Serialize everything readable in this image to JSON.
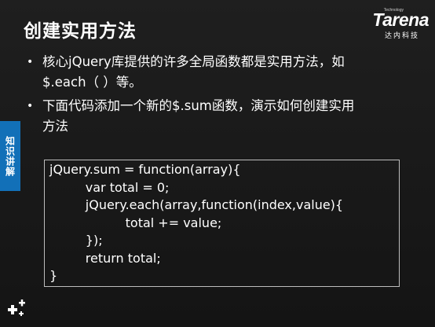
{
  "title": "创建实用方法",
  "logo": {
    "small": "Technology",
    "main": "Tarena",
    "sub": "达内科技"
  },
  "bullets": [
    {
      "line1": "核心jQuery库提供的许多全局函数都是实用方法，如",
      "line2": "$.each（ ）等。"
    },
    {
      "line1": "下面代码添加一个新的$.sum函数，演示如何创建实用",
      "line2": "方法"
    }
  ],
  "side_tab": "知识讲解",
  "code": [
    "jQuery.sum = function(array){",
    "         var total = 0;",
    "         jQuery.each(array,function(index,value){",
    "                   total += value;",
    "         });",
    "         return total;",
    "}"
  ],
  "colors": {
    "background": "#1a1a1a",
    "accent_tab": "#1270b8",
    "text": "#ffffff",
    "border": "#bdbdbd"
  },
  "icons": {
    "corner": "plus-cluster-icon",
    "bullet": "bullet-dot-icon"
  }
}
